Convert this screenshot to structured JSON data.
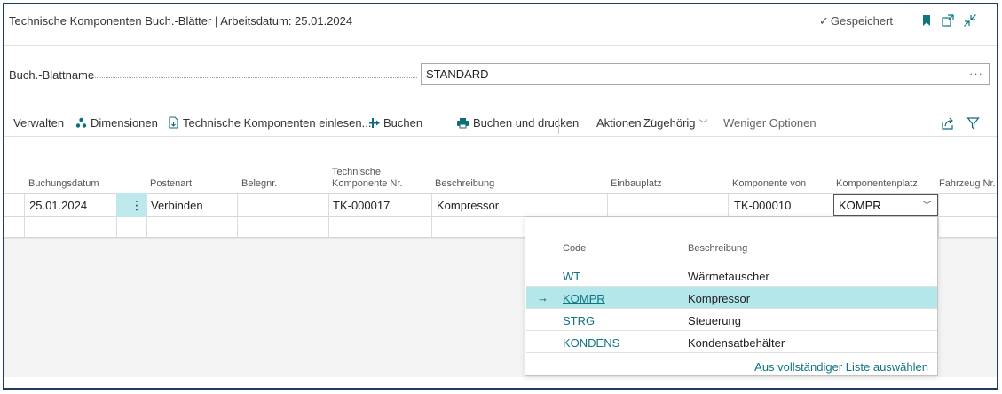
{
  "header": {
    "title": "Technische Komponenten Buch.-Blätter | Arbeitsdatum: 25.01.2024",
    "saved_label": "Gespeichert",
    "icons": [
      "checkmark-icon",
      "bookmark-icon",
      "open-new-window-icon",
      "collapse-icon"
    ]
  },
  "field": {
    "label": "Buch.-Blattname",
    "value": "STANDARD",
    "more": "···"
  },
  "actions": {
    "manage": "Verwalten",
    "dimensions": "Dimensionen",
    "import": "Technische Komponenten einlesen...",
    "post": "Buchen",
    "post_print": "Buchen und drucken",
    "actions": "Aktionen",
    "related": "Zugehörig",
    "fewer": "Weniger Optionen"
  },
  "columns": {
    "posting_date": "Buchungsdatum",
    "entry_type": "Postenart",
    "doc_no": "Belegnr.",
    "tech_comp_line1": "Technische",
    "tech_comp_line2": "Komponente Nr.",
    "description": "Beschreibung",
    "install_place": "Einbauplatz",
    "component_of": "Komponente von",
    "component_place": "Komponentenplatz",
    "vehicle_no": "Fahrzeug Nr."
  },
  "row": {
    "posting_date": "25.01.2024",
    "menu": "⋮",
    "entry_type": "Verbinden",
    "doc_no": "",
    "tech_comp": "TK-000017",
    "description": "Kompressor",
    "install_place": "",
    "component_of": "TK-000010",
    "component_place": "KOMPR"
  },
  "dropdown": {
    "code_header": "Code",
    "desc_header": "Beschreibung",
    "items": [
      {
        "code": "WT",
        "desc": "Wärmetauscher",
        "selected": false
      },
      {
        "code": "KOMPR",
        "desc": "Kompressor",
        "selected": true
      },
      {
        "code": "STRG",
        "desc": "Steuerung",
        "selected": false
      },
      {
        "code": "KONDENS",
        "desc": "Kondensatbehälter",
        "selected": false
      }
    ],
    "arrow": "→",
    "select_full": "Aus vollständiger Liste auswählen"
  },
  "colors": {
    "accent": "#0f7583",
    "selection": "#b4e7ea",
    "frame": "#1c3d63"
  }
}
